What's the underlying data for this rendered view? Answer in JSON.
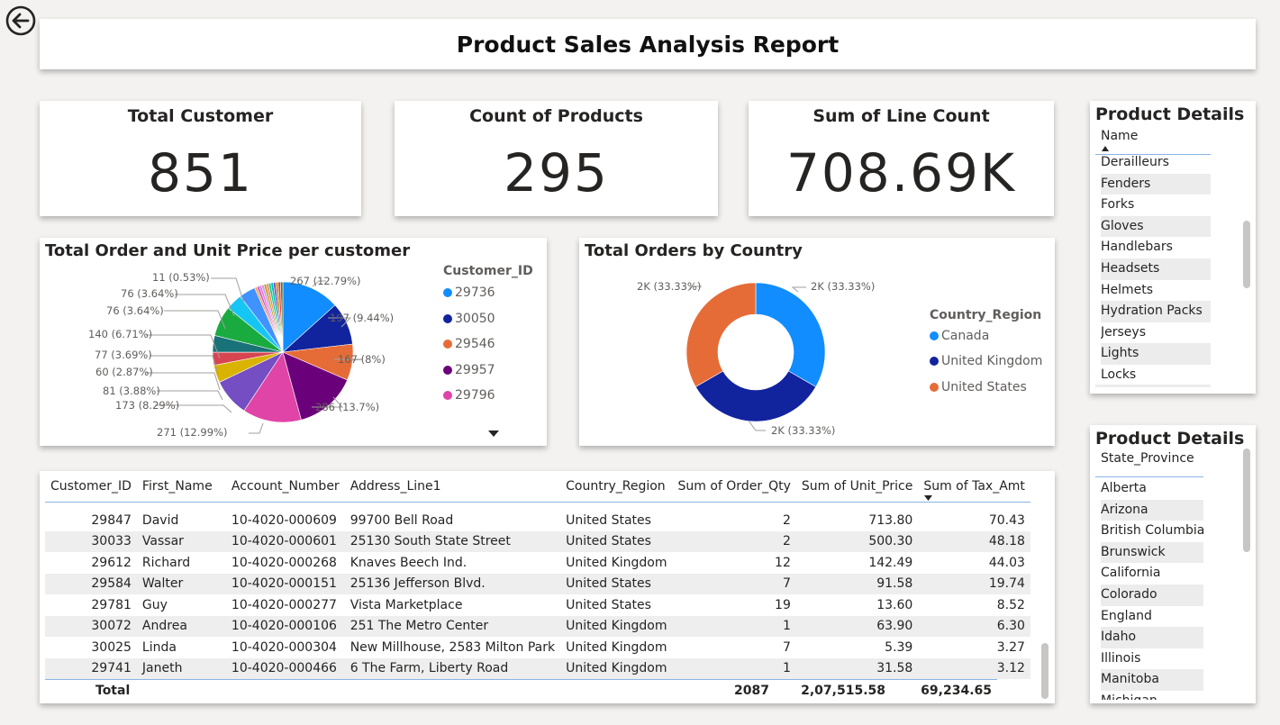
{
  "report_title": "Product Sales Analysis Report",
  "kpis": [
    {
      "label": "Total Customer",
      "value": "851"
    },
    {
      "label": "Count of Products",
      "value": "295"
    },
    {
      "label": "Sum of Line Count",
      "value": "708.69K"
    }
  ],
  "pie_chart": {
    "title": "Total Order and Unit Price per customer",
    "legend_title": "Customer_ID",
    "legend": [
      {
        "name": "29736",
        "color": "#118dff"
      },
      {
        "name": "30050",
        "color": "#12239e"
      },
      {
        "name": "29546",
        "color": "#e66c37"
      },
      {
        "name": "29957",
        "color": "#6b007b"
      },
      {
        "name": "29796",
        "color": "#e044a7"
      }
    ],
    "labels": [
      "267 (12.79%)",
      "197 (9.44%)",
      "167 (8%)",
      "286 (13.7%)",
      "271 (12.99%)",
      "173 (8.29%)",
      "81 (3.88%)",
      "60 (2.87%)",
      "77 (3.69%)",
      "140 (6.71%)",
      "76 (3.64%)",
      "76 (3.64%)",
      "11 (0.53%)"
    ]
  },
  "donut_chart": {
    "title": "Total Orders by Country",
    "legend_title": "Country_Region",
    "legend": [
      {
        "name": "Canada",
        "color": "#118dff"
      },
      {
        "name": "United Kingdom",
        "color": "#12239e"
      },
      {
        "name": "United States",
        "color": "#e66c37"
      }
    ],
    "labels": [
      "2K (33.33%)",
      "2K (33.33%)",
      "2K (33.33%)"
    ]
  },
  "chart_data": [
    {
      "type": "pie",
      "title": "Total Order and Unit Price per customer",
      "legend_title": "Customer_ID",
      "slices": [
        {
          "value": 267,
          "percent": 12.79,
          "color": "#118dff"
        },
        {
          "value": 197,
          "percent": 9.44,
          "color": "#12239e"
        },
        {
          "value": 167,
          "percent": 8.0,
          "color": "#e66c37"
        },
        {
          "value": 286,
          "percent": 13.7,
          "color": "#6b007b"
        },
        {
          "value": 271,
          "percent": 12.99,
          "color": "#e044a7"
        },
        {
          "value": 173,
          "percent": 8.29,
          "color": "#744ec2"
        },
        {
          "value": 81,
          "percent": 3.88,
          "color": "#d9b300"
        },
        {
          "value": 60,
          "percent": 2.87,
          "color": "#d64550"
        },
        {
          "value": 77,
          "percent": 3.69,
          "color": "#197278"
        },
        {
          "value": 140,
          "percent": 6.71,
          "color": "#1aab40"
        },
        {
          "value": 76,
          "percent": 3.64,
          "color": "#15c6f4"
        },
        {
          "value": 76,
          "percent": 3.64,
          "color": "#4092ff"
        },
        {
          "value": 11,
          "percent": 0.53,
          "color": "#ffa058"
        },
        {
          "value": 11,
          "percent": 0.53,
          "color": "#be5dc9"
        },
        {
          "value": 11,
          "percent": 0.53,
          "color": "#f472d0"
        },
        {
          "value": 11,
          "percent": 0.53,
          "color": "#b5a1ff"
        },
        {
          "value": 11,
          "percent": 0.53,
          "color": "#c4a200"
        },
        {
          "value": 11,
          "percent": 0.53,
          "color": "#ff8080"
        },
        {
          "value": 11,
          "percent": 0.53,
          "color": "#00db7d"
        },
        {
          "value": 11,
          "percent": 0.53,
          "color": "#00b7c3"
        },
        {
          "value": 11,
          "percent": 0.53,
          "color": "#7a4cc2"
        },
        {
          "value": 11,
          "percent": 0.53,
          "color": "#c19000"
        },
        {
          "value": 11,
          "percent": 0.53,
          "color": "#e03c50"
        },
        {
          "value": 11,
          "percent": 0.53,
          "color": "#4c7a3a"
        }
      ]
    },
    {
      "type": "pie",
      "title": "Total Orders by Country",
      "legend_title": "Country_Region",
      "slices": [
        {
          "name": "Canada",
          "value": 2000,
          "percent": 33.33,
          "color": "#118dff"
        },
        {
          "name": "United Kingdom",
          "value": 2000,
          "percent": 33.33,
          "color": "#12239e"
        },
        {
          "name": "United States",
          "value": 2000,
          "percent": 33.33,
          "color": "#e66c37"
        }
      ]
    }
  ],
  "product_slicer": {
    "title": "Product Details",
    "field": "Name",
    "items": [
      "Derailleurs",
      "Fenders",
      "Forks",
      "Gloves",
      "Handlebars",
      "Headsets",
      "Helmets",
      "Hydration Packs",
      "Jerseys",
      "Lights",
      "Locks"
    ]
  },
  "state_slicer": {
    "title": "Product Details",
    "field": "State_Province",
    "items": [
      "Alberta",
      "Arizona",
      "British Columbia",
      "Brunswick",
      "California",
      "Colorado",
      "England",
      "Idaho",
      "Illinois",
      "Manitoba",
      "Michigan"
    ]
  },
  "table": {
    "columns": [
      "Customer_ID",
      "First_Name",
      "Account_Number",
      "Address_Line1",
      "Country_Region",
      "Sum of Order_Qty",
      "Sum of Unit_Price",
      "Sum of Tax_Amt"
    ],
    "rows": [
      [
        "29847",
        "David",
        "10-4020-000609",
        "99700 Bell Road",
        "United States",
        "2",
        "713.80",
        "70.43"
      ],
      [
        "30033",
        "Vassar",
        "10-4020-000601",
        "25130 South State Street",
        "United States",
        "2",
        "500.30",
        "48.18"
      ],
      [
        "29612",
        "Richard",
        "10-4020-000268",
        "Knaves Beech Ind.",
        "United Kingdom",
        "12",
        "142.49",
        "44.03"
      ],
      [
        "29584",
        "Walter",
        "10-4020-000151",
        "25136 Jefferson Blvd.",
        "United States",
        "7",
        "91.58",
        "19.74"
      ],
      [
        "29781",
        "Guy",
        "10-4020-000277",
        "Vista Marketplace",
        "United States",
        "19",
        "13.60",
        "8.52"
      ],
      [
        "30072",
        "Andrea",
        "10-4020-000106",
        "251 The Metro Center",
        "United Kingdom",
        "1",
        "63.90",
        "6.30"
      ],
      [
        "30025",
        "Linda",
        "10-4020-000304",
        "New Millhouse, 2583 Milton Park",
        "United Kingdom",
        "7",
        "5.39",
        "3.27"
      ],
      [
        "29741",
        "Janeth",
        "10-4020-000466",
        "6 The Farm, Liberty Road",
        "United Kingdom",
        "1",
        "31.58",
        "3.12"
      ]
    ],
    "total_label": "Total",
    "total_order_qty": "2087",
    "total_unit_price": "2,07,515.58",
    "total_tax_amt": "69,234.65"
  }
}
